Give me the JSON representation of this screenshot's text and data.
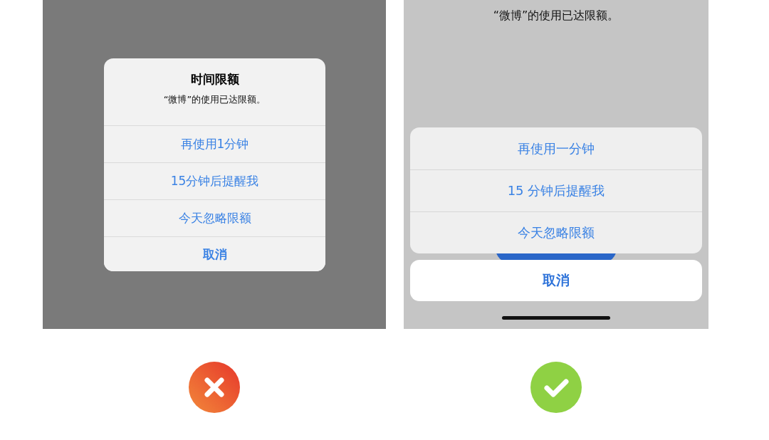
{
  "panels": [
    {
      "kind": "alert",
      "correct": false,
      "title": "时间限额",
      "message": "“微博”的使用已达限额。",
      "actions": [
        {
          "label": "再使用1分钟",
          "kind": "default"
        },
        {
          "label": "15分钟后提醒我",
          "kind": "default"
        },
        {
          "label": "今天忽略限额",
          "kind": "default"
        },
        {
          "label": "取消",
          "kind": "cancel"
        }
      ]
    },
    {
      "kind": "action_sheet",
      "correct": true,
      "message": "“微博”的使用已达限额。",
      "actions": [
        {
          "label": "再使用一分钟",
          "kind": "default"
        },
        {
          "label": "15 分钟后提醒我",
          "kind": "default"
        },
        {
          "label": "今天忽略限额",
          "kind": "default"
        },
        {
          "label": "取消",
          "kind": "cancel"
        }
      ]
    }
  ]
}
